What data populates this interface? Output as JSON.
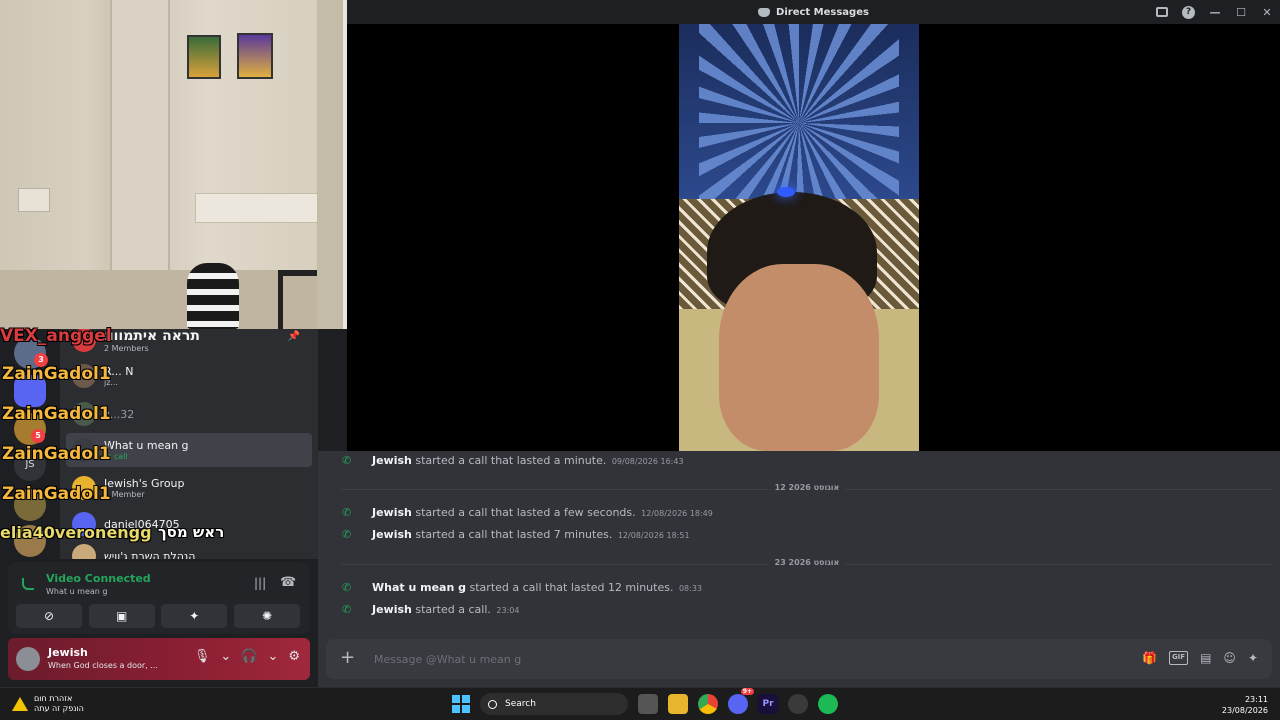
{
  "window": {
    "title": "Direct Messages",
    "controls": {
      "minimize": "—",
      "maximize": "☐",
      "close": "✕",
      "help": "?"
    }
  },
  "overlay": {
    "top_name": "VEX_anggel",
    "repeated_name": "ZainGadol1",
    "bottom_name": "elia40veronengg",
    "bottom_hebrew": "ראש מסך",
    "color": "#f5b83d"
  },
  "rail": {
    "badges": [
      "3",
      "5"
    ],
    "js_label": "JS"
  },
  "dm_list": {
    "group_title": "תראה איתמוווו",
    "group_members": "2 Members",
    "items": [
      {
        "name": "R... N",
        "sub": "jz..."
      },
      {
        "name": "z...32",
        "sub": ""
      },
      {
        "name": "What u mean g",
        "sub": "In call"
      },
      {
        "name": "Jewish's Group",
        "sub": "1 Member"
      },
      {
        "name": "daniel064705",
        "sub": ""
      },
      {
        "name": "הנהלת השרת ג'וויש",
        "sub": ""
      }
    ]
  },
  "voice": {
    "status": "Video Connected",
    "channel": "What u mean g"
  },
  "user": {
    "name": "Jewish",
    "status": "When God closes a door, ..."
  },
  "chat": {
    "messages": [
      {
        "who": "Jewish",
        "text": "started a call that lasted a minute.",
        "ts": "09/08/2026 16:43"
      },
      {
        "who": "Jewish",
        "text": "started a call that lasted a few seconds.",
        "ts": "12/08/2026 18:49"
      },
      {
        "who": "Jewish",
        "text": "started a call that lasted 7 minutes.",
        "ts": "12/08/2026 18:51"
      },
      {
        "who": "What u mean g",
        "text": "started a call that lasted 12 minutes.",
        "ts": "08:33"
      },
      {
        "who": "Jewish",
        "text": "started a call.",
        "ts": "23:04"
      }
    ],
    "dividers": [
      "12 אוגוסט 2026",
      "23 אוגוסט 2026"
    ],
    "composer_placeholder": "Message @What u mean g"
  },
  "taskbar": {
    "weather_line1": "אזהרת חום",
    "weather_line2": "הונפק זה עתה",
    "search_label": "Search",
    "discord_badge": "9+",
    "premiere_label": "Pr",
    "time": "23:11",
    "date": "23/08/2026"
  },
  "colors": {
    "accent_green": "#23a55a",
    "discord_blurple": "#5865f2",
    "user_panel": "#8b1f33"
  }
}
